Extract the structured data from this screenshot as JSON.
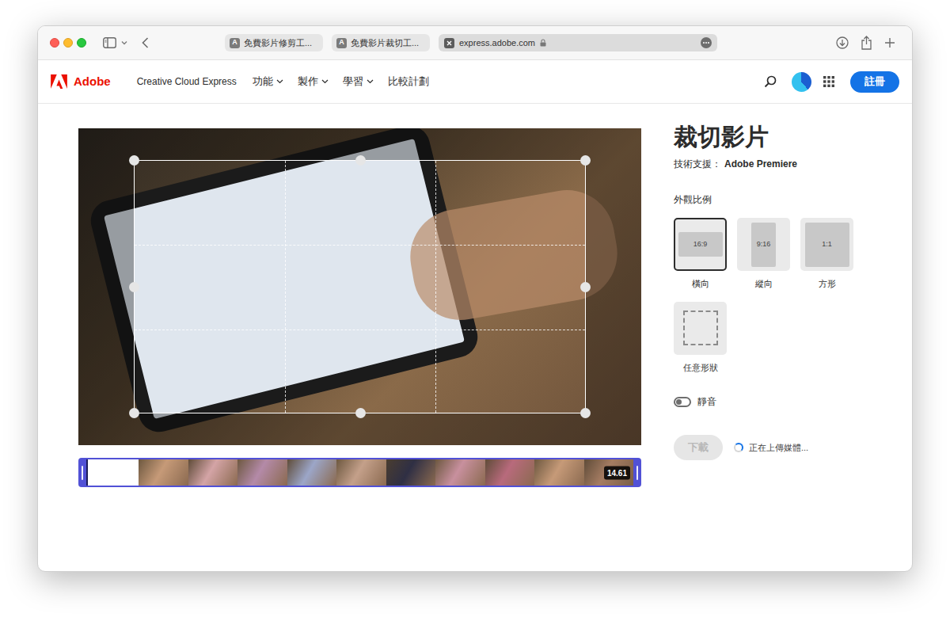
{
  "browser": {
    "tabs": [
      {
        "favicon": "A",
        "label": "免費影片修剪工...",
        "selected": false
      },
      {
        "favicon": "A",
        "label": "免費影片裁切工...",
        "selected": false
      },
      {
        "label": "express.adobe.com",
        "selected": true
      }
    ]
  },
  "nav": {
    "brand": "Adobe",
    "product": "Creative Cloud Express",
    "menu": [
      {
        "label": "功能",
        "has_dropdown": true
      },
      {
        "label": "製作",
        "has_dropdown": true
      },
      {
        "label": "學習",
        "has_dropdown": true
      },
      {
        "label": "比較計劃",
        "has_dropdown": false
      }
    ],
    "signup": "註冊"
  },
  "editor": {
    "timeline": {
      "duration": "14.61"
    }
  },
  "panel": {
    "title": "裁切影片",
    "powered_label": "技術支援：",
    "powered_by": "Adobe Premiere",
    "ratio_heading": "外觀比例",
    "ratios": [
      {
        "preview": "16:9",
        "label": "橫向",
        "kind": "landscape",
        "selected": true
      },
      {
        "preview": "9:16",
        "label": "縱向",
        "kind": "portrait",
        "selected": false
      },
      {
        "preview": "1:1",
        "label": "方形",
        "kind": "square",
        "selected": false
      },
      {
        "label": "任意形狀",
        "kind": "free",
        "selected": false
      }
    ],
    "mute": {
      "label": "靜音",
      "on": false
    },
    "download": {
      "label": "下載",
      "disabled": true
    },
    "status": {
      "text": "正在上傳媒體...",
      "loading": true
    }
  }
}
